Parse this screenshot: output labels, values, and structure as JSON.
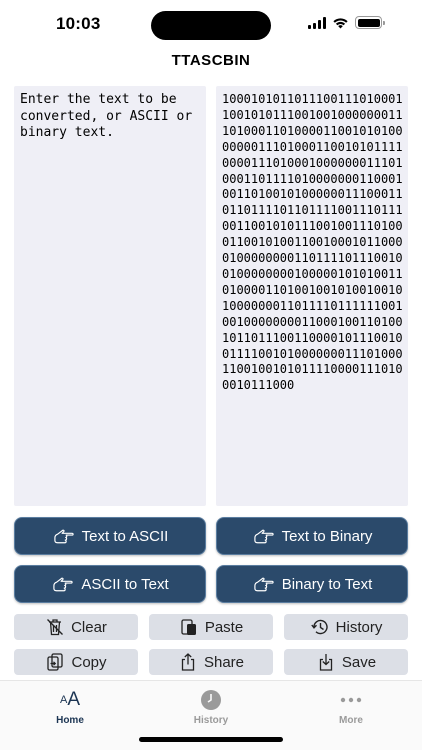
{
  "status": {
    "time": "10:03"
  },
  "app": {
    "title": "TTASCBIN"
  },
  "input": {
    "placeholder": "Enter the text to be converted, or ASCII or binary text."
  },
  "output": {
    "text": "1000101011011100111010001100101011100100100000001110100011010000110010101000000011101000110010101111000011101000100000001110100011011110100000001100010011010010100000011100011011011110110111100111011100110010101110010011101000110010100110010001011000010000000011011110111001001000000001000001010100110100001101001001010010010100000001101111011111100100100000000110001001101001011011100110000101110010011110010100000001110100011001001010111100001110100010111000"
  },
  "buttons": {
    "text_to_ascii": "Text to ASCII",
    "text_to_binary": "Text to Binary",
    "ascii_to_text": "ASCII to Text",
    "binary_to_text": "Binary to Text",
    "clear": "Clear",
    "paste": "Paste",
    "history": "History",
    "copy": "Copy",
    "share": "Share",
    "save": "Save"
  },
  "tabs": [
    {
      "label": "Home",
      "icon": "text-size-icon",
      "active": true
    },
    {
      "label": "History",
      "icon": "clock-icon",
      "active": false
    },
    {
      "label": "More",
      "icon": "ellipsis-icon",
      "active": false
    }
  ],
  "colors": {
    "primary_button": "#2b4a6b",
    "primary_button_border": "#5a7da0",
    "secondary_button": "#dcdfe6",
    "pane_background": "#efeff6",
    "tab_active": "#1c3553",
    "tab_inactive": "#9a9a9a"
  }
}
